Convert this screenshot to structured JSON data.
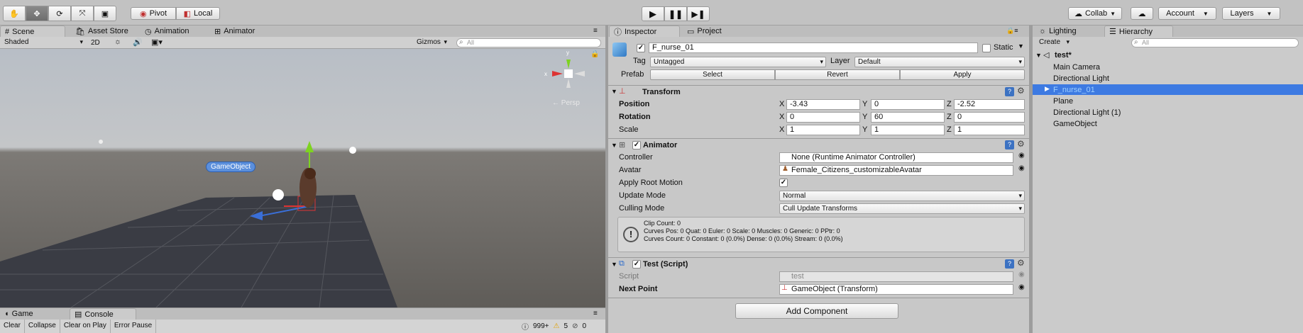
{
  "toolbar": {
    "pivot": "Pivot",
    "local": "Local",
    "collab": "Collab",
    "account": "Account",
    "layers": "Layers"
  },
  "scene_tabs": [
    "Scene",
    "Asset Store",
    "Animation",
    "Animator"
  ],
  "scene_bar": {
    "shading": "Shaded",
    "mode_2d": "2D",
    "gizmos": "Gizmos",
    "search_placeholder": "All"
  },
  "scene": {
    "persp": "← Persp",
    "selected_label": "GameObject",
    "axis_x": "x",
    "axis_y": "y"
  },
  "bottom_tabs": [
    "Game",
    "Console"
  ],
  "console_bar": {
    "clear": "Clear",
    "collapse": "Collapse",
    "clear_on_play": "Clear on Play",
    "error_pause": "Error Pause",
    "logs": "999+",
    "warnings": "5",
    "errors": "0"
  },
  "inspector_tabs": [
    "Inspector",
    "Project"
  ],
  "inspector": {
    "object_name": "F_nurse_01",
    "static": "Static",
    "tag_label": "Tag",
    "tag": "Untagged",
    "layer_label": "Layer",
    "layer": "Default",
    "prefab_label": "Prefab",
    "prefab_select": "Select",
    "prefab_revert": "Revert",
    "prefab_apply": "Apply",
    "transform": {
      "title": "Transform",
      "rows": [
        {
          "label": "Position",
          "x": "-3.43",
          "y": "0",
          "z": "-2.52"
        },
        {
          "label": "Rotation",
          "x": "0",
          "y": "60",
          "z": "0"
        },
        {
          "label": "Scale",
          "x": "1",
          "y": "1",
          "z": "1"
        }
      ]
    },
    "animator": {
      "title": "Animator",
      "controller_label": "Controller",
      "controller": "None (Runtime Animator Controller)",
      "avatar_label": "Avatar",
      "avatar": "Female_Citizens_customizableAvatar",
      "apply_root_label": "Apply Root Motion",
      "update_label": "Update Mode",
      "update": "Normal",
      "culling_label": "Culling Mode",
      "culling": "Cull Update Transforms",
      "info": [
        "Clip Count: 0",
        "Curves Pos: 0 Quat: 0 Euler: 0 Scale: 0 Muscles: 0 Generic: 0 PPtr: 0",
        "Curves Count: 0 Constant: 0 (0.0%) Dense: 0 (0.0%) Stream: 0 (0.0%)"
      ]
    },
    "script": {
      "title": "Test (Script)",
      "script_label": "Script",
      "script": "test",
      "next_label": "Next Point",
      "next": "GameObject (Transform)"
    },
    "add_component": "Add Component"
  },
  "right_tabs": [
    "Lighting",
    "Hierarchy"
  ],
  "hierarchy": {
    "create": "Create",
    "search_placeholder": "All",
    "scene": "test*",
    "items": [
      "Main Camera",
      "Directional Light",
      "F_nurse_01",
      "Plane",
      "Directional Light (1)",
      "GameObject"
    ]
  },
  "colors": {
    "selection": "#3d7ae2",
    "sky": "#c8cdd2",
    "ground": "#3a3c44"
  }
}
